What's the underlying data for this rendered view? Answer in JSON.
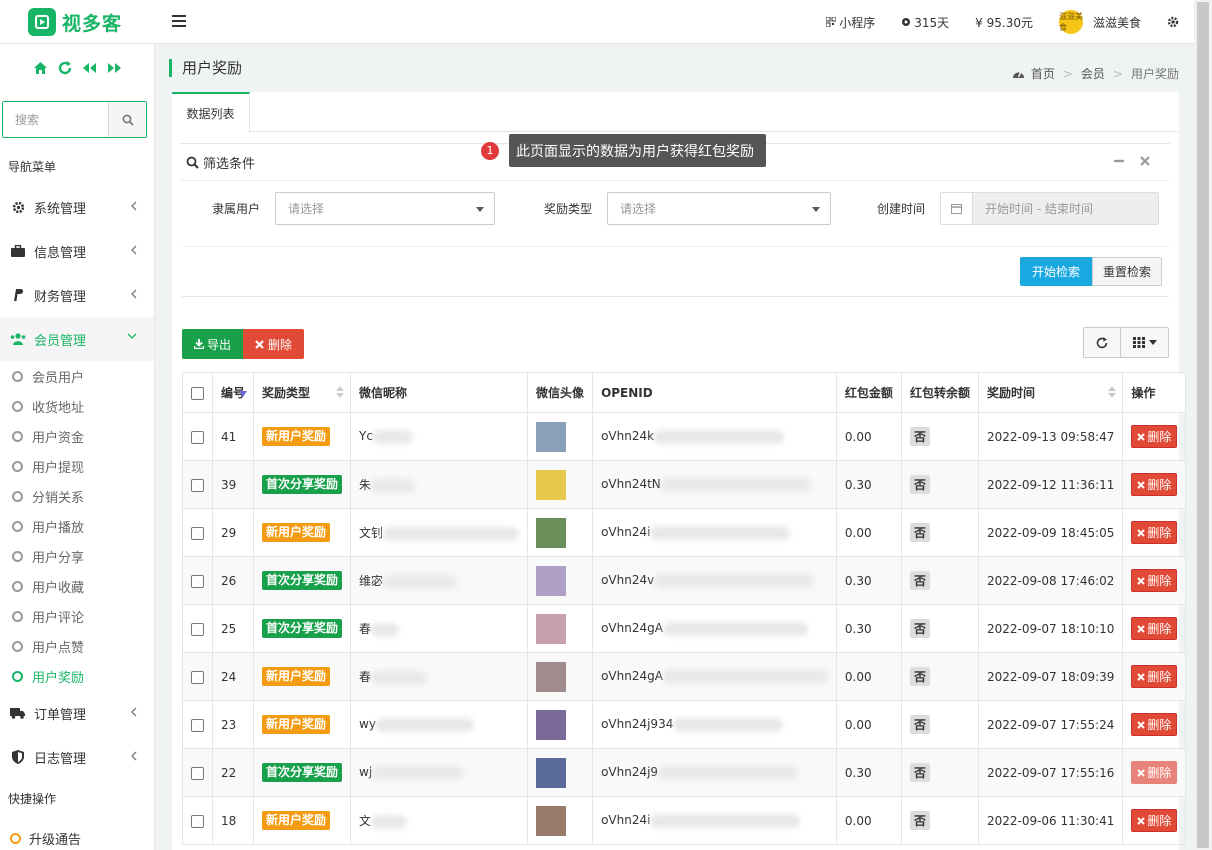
{
  "app": {
    "logo_text": "视多客"
  },
  "topbar": {
    "miniprogram": "小程序",
    "days": "315天",
    "balance": "¥ 95.30元",
    "username": "滋滋美食",
    "avatar_text": "滋滋美食"
  },
  "sidebar": {
    "search_placeholder": "搜索",
    "nav_header": "导航菜单",
    "menu": [
      {
        "label": "系统管理",
        "icon": "gear-icon"
      },
      {
        "label": "信息管理",
        "icon": "briefcase-icon"
      },
      {
        "label": "财务管理",
        "icon": "paypal-icon"
      },
      {
        "label": "会员管理",
        "icon": "users-icon"
      },
      {
        "label": "订单管理",
        "icon": "truck-icon"
      },
      {
        "label": "日志管理",
        "icon": "shield-icon"
      }
    ],
    "submenu": [
      "会员用户",
      "收货地址",
      "用户资金",
      "用户提现",
      "分销关系",
      "用户播放",
      "用户分享",
      "用户收藏",
      "用户评论",
      "用户点赞",
      "用户奖励"
    ],
    "quick_header": "快捷操作",
    "quick_items": [
      "升级通告"
    ]
  },
  "page": {
    "title": "用户奖励",
    "breadcrumb": [
      "首页",
      "会员",
      "用户奖励"
    ],
    "tab": "数据列表",
    "filter_title": "筛选条件",
    "tip_number": "1",
    "tip_text": "此页面显示的数据为用户获得红包奖励"
  },
  "filters": {
    "user_label": "隶属用户",
    "user_placeholder": "请选择",
    "type_label": "奖励类型",
    "type_placeholder": "请选择",
    "time_label": "创建时间",
    "time_placeholder": "开始时间 - 结束时间",
    "search_btn": "开始检索",
    "reset_btn": "重置检索"
  },
  "toolbar": {
    "export": "导出",
    "delete": "删除"
  },
  "table": {
    "headers": [
      "编号",
      "奖励类型",
      "微信昵称",
      "微信头像",
      "OPENID",
      "红包金额",
      "红包转余额",
      "奖励时间",
      "操作"
    ],
    "rows": [
      {
        "id": "41",
        "type": "新用户奖励",
        "nick": "Yc",
        "openid": "oVhn24k",
        "amount": "0.00",
        "to_balance": "否",
        "time": "2022-09-13 09:58:47"
      },
      {
        "id": "39",
        "type": "首次分享奖励",
        "nick": "朱",
        "openid": "oVhn24tN",
        "amount": "0.30",
        "to_balance": "否",
        "time": "2022-09-12 11:36:11"
      },
      {
        "id": "29",
        "type": "新用户奖励",
        "nick": "文钊",
        "openid": "oVhn24i",
        "amount": "0.00",
        "to_balance": "否",
        "time": "2022-09-09 18:45:05"
      },
      {
        "id": "26",
        "type": "首次分享奖励",
        "nick": "维宓",
        "openid": "oVhn24v",
        "amount": "0.30",
        "to_balance": "否",
        "time": "2022-09-08 17:46:02"
      },
      {
        "id": "25",
        "type": "首次分享奖励",
        "nick": "春",
        "openid": "oVhn24gA",
        "amount": "0.30",
        "to_balance": "否",
        "time": "2022-09-07 18:10:10"
      },
      {
        "id": "24",
        "type": "新用户奖励",
        "nick": "春",
        "openid": "oVhn24gA",
        "amount": "0.00",
        "to_balance": "否",
        "time": "2022-09-07 18:09:39"
      },
      {
        "id": "23",
        "type": "新用户奖励",
        "nick": "wy",
        "openid": "oVhn24j934",
        "amount": "0.00",
        "to_balance": "否",
        "time": "2022-09-07 17:55:24"
      },
      {
        "id": "22",
        "type": "首次分享奖励",
        "nick": "wj",
        "openid": "oVhn24j9",
        "amount": "0.30",
        "to_balance": "否",
        "time": "2022-09-07 17:55:16"
      },
      {
        "id": "18",
        "type": "新用户奖励",
        "nick": "文",
        "openid": "oVhn24i",
        "amount": "0.00",
        "to_balance": "否",
        "time": "2022-09-06 11:30:41"
      }
    ],
    "delete_label": "删除"
  },
  "colors": {
    "accent": "#18b566",
    "danger": "#e04a36",
    "info": "#1aa8e0",
    "warning": "#f39c12"
  }
}
